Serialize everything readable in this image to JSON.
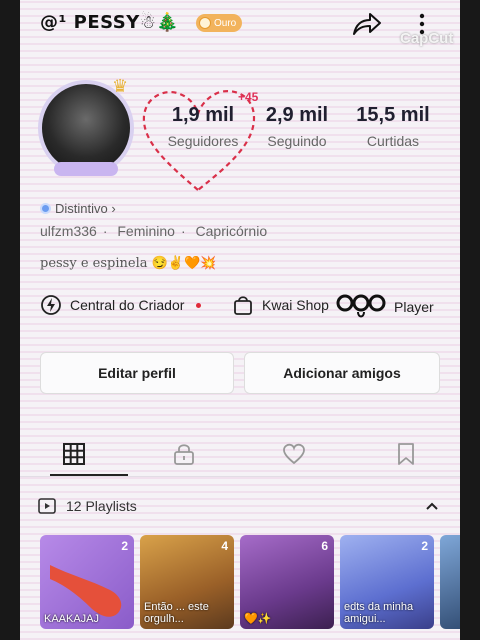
{
  "profile": {
    "username": "@¹ PESSY☃🎄",
    "badge_label": "Ouro",
    "watermark": "CapCut"
  },
  "stats": [
    {
      "value": "1,9 mil",
      "label": "Seguidores"
    },
    {
      "value": "2,9 mil",
      "label": "Seguindo"
    },
    {
      "value": "15,5 mil",
      "label": "Curtidas"
    }
  ],
  "heart_badge": "+45",
  "info": {
    "distintivo": "Distintivo ›",
    "handle": "ulfzm336",
    "gender": "Feminino",
    "sign": "Capricórnio",
    "bio": "pessy e espinela 😏✌️🧡💥"
  },
  "shortcuts": {
    "creator": "Central do Criador",
    "shop": "Kwai Shop",
    "player": "Player"
  },
  "buttons": {
    "edit": "Editar perfil",
    "add_friends": "Adicionar amigos"
  },
  "playlists": {
    "label": "12 Playlists",
    "items": [
      {
        "count": "2",
        "caption": "KAAKAJAJ",
        "color": "#9b6fd6"
      },
      {
        "count": "4",
        "caption": "Então ... este orgulh...",
        "color": "#b5863c"
      },
      {
        "count": "6",
        "caption": "🧡✨",
        "color": "#7b4a9a"
      },
      {
        "count": "2",
        "caption": "edts da minha amigui...",
        "color": "#6e82d8"
      }
    ]
  },
  "colors": {
    "accent_red": "#e0335a",
    "badge_gold": "#f2b35c"
  }
}
